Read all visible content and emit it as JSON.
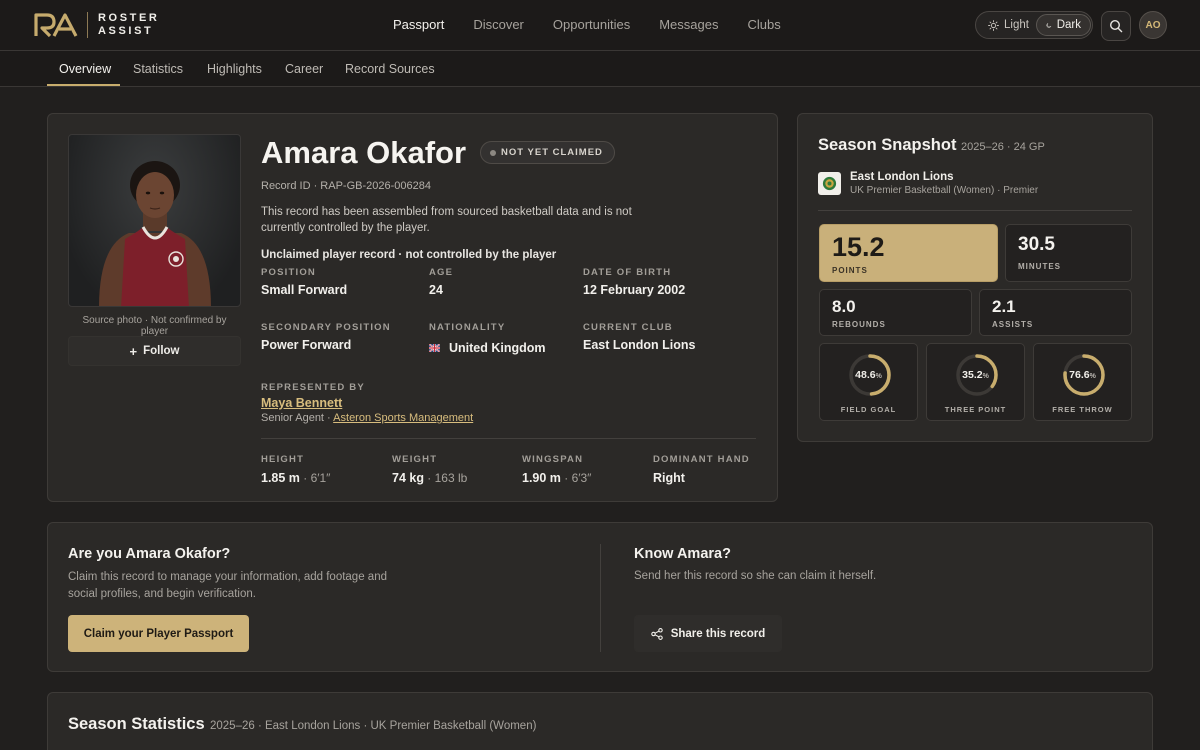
{
  "brand": {
    "line1": "ROSTER",
    "line2": "ASSIST",
    "accent": "#c8ad6d"
  },
  "nav": {
    "items": [
      "Passport",
      "Discover",
      "Opportunities",
      "Messages",
      "Clubs"
    ],
    "active": "Passport"
  },
  "theme": {
    "light_label": "Light",
    "dark_label": "Dark",
    "selected": "Dark"
  },
  "user": {
    "initials": "AO"
  },
  "tabs": {
    "items": [
      "Overview",
      "Statistics",
      "Highlights",
      "Career",
      "Record Sources"
    ],
    "active": "Overview"
  },
  "profile": {
    "name": "Amara Okafor",
    "status": "NOT YET CLAIMED",
    "record_id": "Record ID · RAP-GB-2026-006284",
    "description": "This record has been assembled from sourced basketball data and is not currently controlled by the player.",
    "unclaimed_note": "Unclaimed player record · not controlled by the player",
    "photo_caption": "Source photo · Not confirmed by player",
    "follow_label": "Follow",
    "fields": {
      "position": {
        "label": "POSITION",
        "value": "Small Forward"
      },
      "age": {
        "label": "AGE",
        "value": "24"
      },
      "dob": {
        "label": "DATE OF BIRTH",
        "value": "12 February 2002"
      },
      "secondary_position": {
        "label": "SECONDARY POSITION",
        "value": "Power Forward"
      },
      "nationality": {
        "label": "NATIONALITY",
        "value": "United Kingdom"
      },
      "current_club": {
        "label": "CURRENT CLUB",
        "value": "East London Lions"
      }
    },
    "representation": {
      "label": "REPRESENTED BY",
      "agent": "Maya Bennett",
      "role": "Senior Agent · ",
      "agency": "Asteron Sports Management"
    },
    "physical": {
      "height": {
        "label": "HEIGHT",
        "primary": "1.85 m",
        "secondary": " · 6′1″"
      },
      "weight": {
        "label": "WEIGHT",
        "primary": "74 kg",
        "secondary": " · 163 lb"
      },
      "wingspan": {
        "label": "WINGSPAN",
        "primary": "1.90 m",
        "secondary": " · 6′3″"
      },
      "hand": {
        "label": "DOMINANT HAND",
        "primary": "Right",
        "secondary": ""
      }
    }
  },
  "snapshot": {
    "title": "Season Snapshot",
    "meta": "2025–26 · 24 GP",
    "club": "East London Lions",
    "league": "UK Premier Basketball (Women) · Premier",
    "stats": {
      "points": {
        "value": "15.2",
        "label": "POINTS"
      },
      "minutes": {
        "value": "30.5",
        "label": "MINUTES"
      },
      "rebounds": {
        "value": "8.0",
        "label": "REBOUNDS"
      },
      "assists": {
        "value": "2.1",
        "label": "ASSISTS"
      }
    },
    "rings": [
      {
        "value": "48.6",
        "pct": 48.6,
        "label": "FIELD GOAL"
      },
      {
        "value": "35.2",
        "pct": 35.2,
        "label": "THREE POINT"
      },
      {
        "value": "76.6",
        "pct": 76.6,
        "label": "FREE THROW"
      }
    ],
    "percent_symbol": "%"
  },
  "claim": {
    "title": "Are you Amara Okafor?",
    "body": "Claim this record to manage your information, add footage and social profiles, and begin verification.",
    "button": "Claim your Player Passport",
    "know_title": "Know Amara?",
    "know_body": "Send her this record so she can claim it herself.",
    "share_button": "Share this record"
  },
  "season_stats": {
    "title": "Season Statistics",
    "meta": "2025–26 · East London Lions · UK Premier Basketball (Women)"
  }
}
